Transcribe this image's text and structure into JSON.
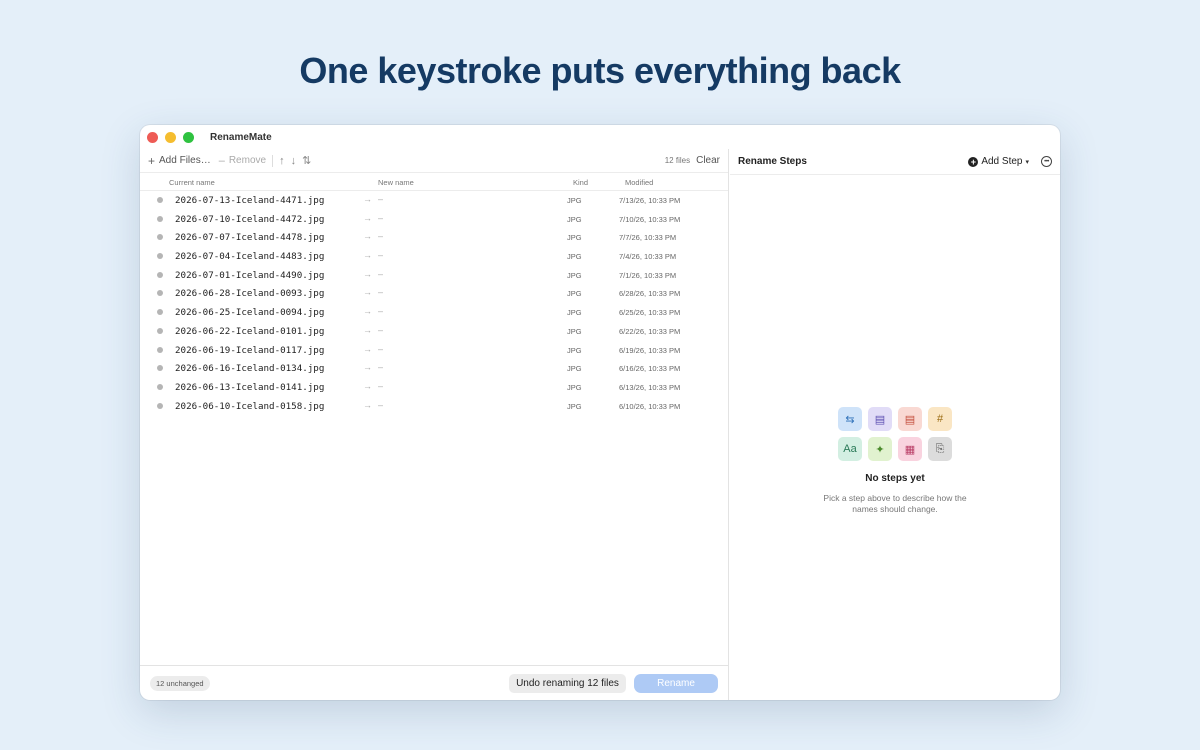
{
  "headline": "One keystroke puts everything back",
  "window": {
    "title": "RenameMate"
  },
  "toolbar": {
    "add_files": "Add Files…",
    "remove": "Remove",
    "file_count": "12 files",
    "clear": "Clear"
  },
  "columns": {
    "current": "Current name",
    "new": "New name",
    "kind": "Kind",
    "modified": "Modified"
  },
  "files": [
    {
      "name": "2026-07-13-Iceland-4471.jpg",
      "new": "–",
      "kind": "JPG",
      "modified": "7/13/26, 10:33 PM"
    },
    {
      "name": "2026-07-10-Iceland-4472.jpg",
      "new": "–",
      "kind": "JPG",
      "modified": "7/10/26, 10:33 PM"
    },
    {
      "name": "2026-07-07-Iceland-4478.jpg",
      "new": "–",
      "kind": "JPG",
      "modified": "7/7/26, 10:33 PM"
    },
    {
      "name": "2026-07-04-Iceland-4483.jpg",
      "new": "–",
      "kind": "JPG",
      "modified": "7/4/26, 10:33 PM"
    },
    {
      "name": "2026-07-01-Iceland-4490.jpg",
      "new": "–",
      "kind": "JPG",
      "modified": "7/1/26, 10:33 PM"
    },
    {
      "name": "2026-06-28-Iceland-0093.jpg",
      "new": "–",
      "kind": "JPG",
      "modified": "6/28/26, 10:33 PM"
    },
    {
      "name": "2026-06-25-Iceland-0094.jpg",
      "new": "–",
      "kind": "JPG",
      "modified": "6/25/26, 10:33 PM"
    },
    {
      "name": "2026-06-22-Iceland-0101.jpg",
      "new": "–",
      "kind": "JPG",
      "modified": "6/22/26, 10:33 PM"
    },
    {
      "name": "2026-06-19-Iceland-0117.jpg",
      "new": "–",
      "kind": "JPG",
      "modified": "6/19/26, 10:33 PM"
    },
    {
      "name": "2026-06-16-Iceland-0134.jpg",
      "new": "–",
      "kind": "JPG",
      "modified": "6/16/26, 10:33 PM"
    },
    {
      "name": "2026-06-13-Iceland-0141.jpg",
      "new": "–",
      "kind": "JPG",
      "modified": "6/13/26, 10:33 PM"
    },
    {
      "name": "2026-06-10-Iceland-0158.jpg",
      "new": "–",
      "kind": "JPG",
      "modified": "6/10/26, 10:33 PM"
    }
  ],
  "footer": {
    "status": "12 unchanged",
    "undo": "Undo renaming 12 files",
    "rename": "Rename"
  },
  "steps_panel": {
    "title": "Rename Steps",
    "add_step": "Add Step",
    "empty_title": "No steps yet",
    "empty_desc": "Pick a step above to describe how the names should change.",
    "step_icons": [
      {
        "name": "replace-icon",
        "glyph": "⇆",
        "bg": "#cfe3f9",
        "fg": "#2c6fb8"
      },
      {
        "name": "list-icon",
        "glyph": "▤",
        "bg": "#e1dcf7",
        "fg": "#5a4cb0"
      },
      {
        "name": "format-icon",
        "glyph": "▤",
        "bg": "#f9d9d3",
        "fg": "#c24a3a"
      },
      {
        "name": "number-icon",
        "glyph": "#",
        "bg": "#fae6c4",
        "fg": "#9a6a10"
      },
      {
        "name": "case-icon",
        "glyph": "Aa",
        "bg": "#d3efe2",
        "fg": "#2a7a58"
      },
      {
        "name": "sparkle-icon",
        "glyph": "✦",
        "bg": "#e1f2cf",
        "fg": "#4a8a2a"
      },
      {
        "name": "calendar-icon",
        "glyph": "▦",
        "bg": "#f9d3df",
        "fg": "#b83a64"
      },
      {
        "name": "file-icon",
        "glyph": "⎘",
        "bg": "#dcdcdc",
        "fg": "#555555"
      }
    ]
  }
}
